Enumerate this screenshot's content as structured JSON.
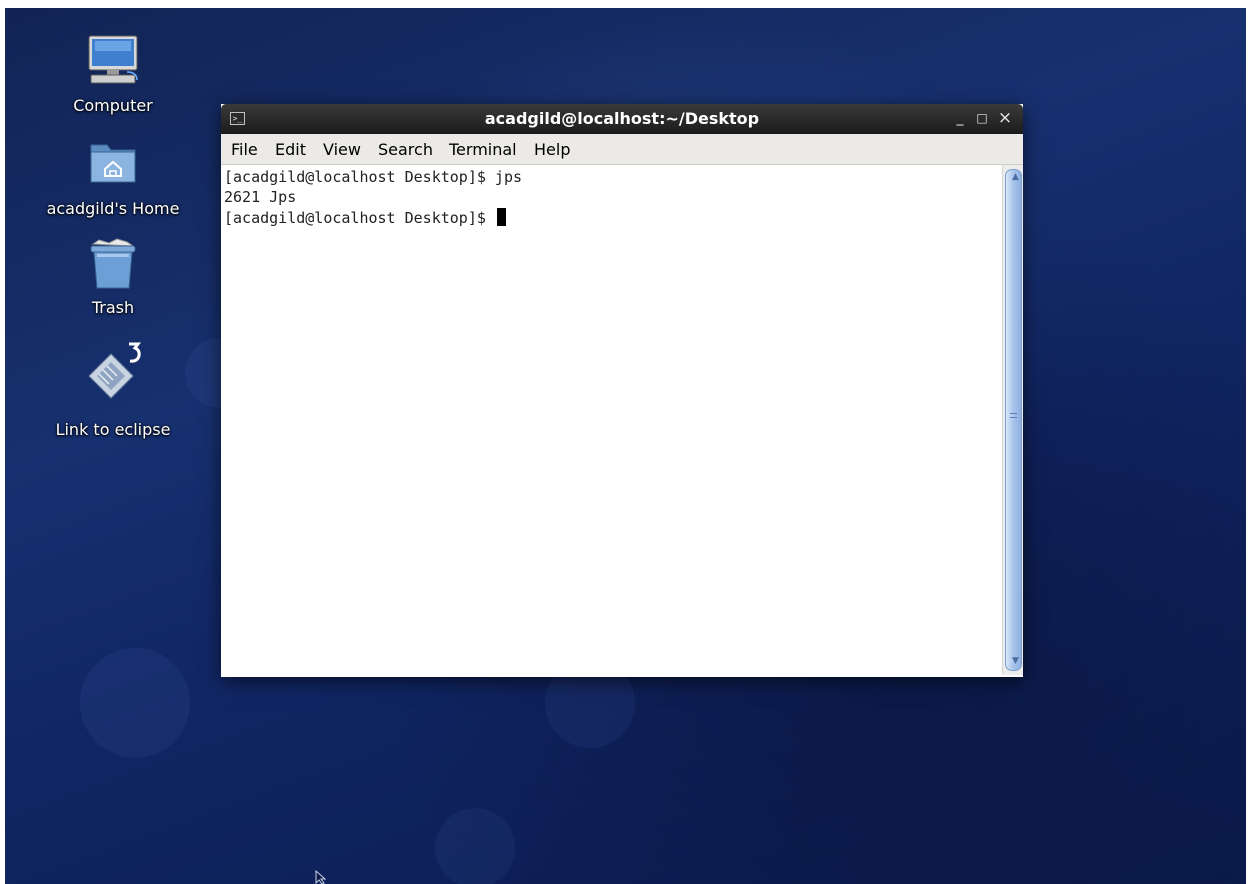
{
  "desktop": {
    "icons": [
      {
        "label": "Computer"
      },
      {
        "label": "acadgild's Home"
      },
      {
        "label": "Trash"
      },
      {
        "label": "Link to eclipse"
      }
    ]
  },
  "terminal": {
    "title": "acadgild@localhost:~/Desktop",
    "controls": {
      "minimize": "_",
      "maximize": "□",
      "close": "×"
    },
    "menu": [
      "File",
      "Edit",
      "View",
      "Search",
      "Terminal",
      "Help"
    ],
    "lines": [
      "[acadgild@localhost Desktop]$ jps",
      "2621 Jps",
      "[acadgild@localhost Desktop]$ "
    ]
  },
  "colors": {
    "desktop_bg": "#142a68",
    "titlebar": "#2a2a2a",
    "scroll_thumb": "#a7c3ea"
  }
}
